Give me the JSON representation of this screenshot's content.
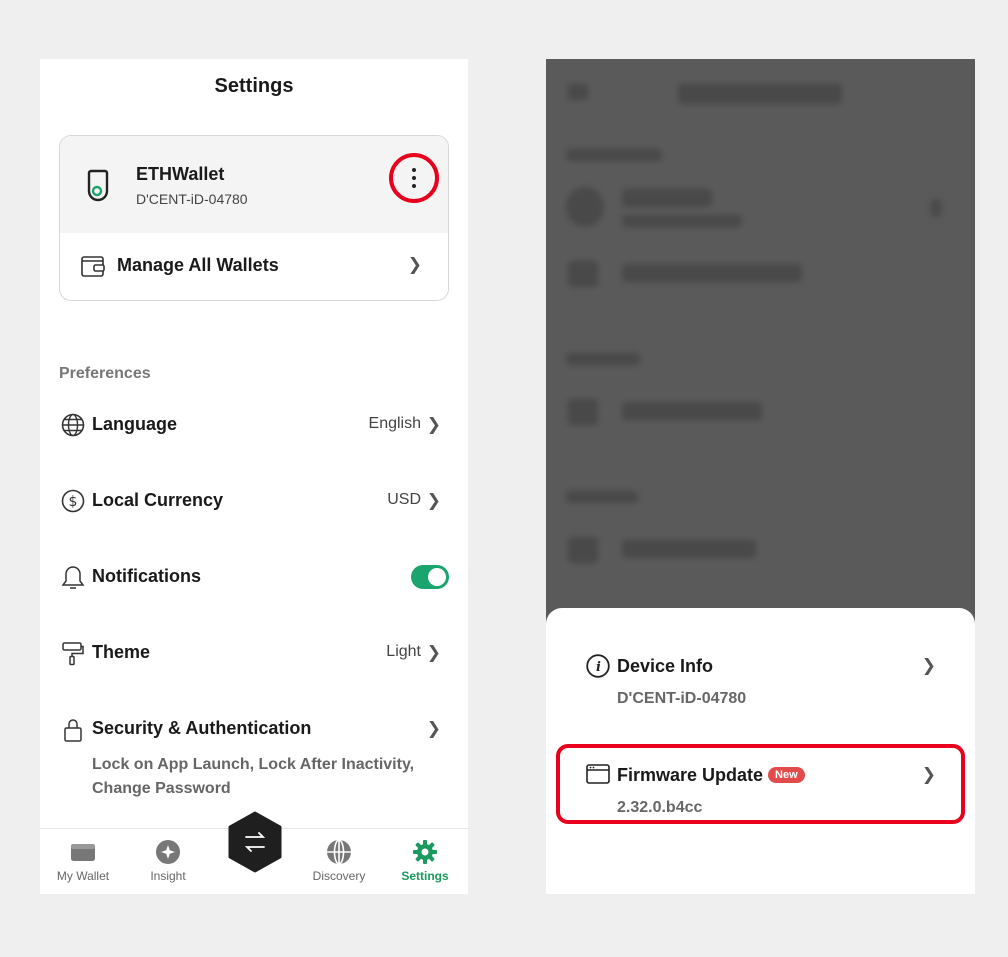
{
  "left": {
    "title": "Settings",
    "wallet": {
      "name": "ETHWallet",
      "id": "D'CENT-iD-04780",
      "menu_icon": "kebab-icon"
    },
    "manage_label": "Manage All Wallets",
    "preferences_label": "Preferences",
    "rows": {
      "language": {
        "label": "Language",
        "value": "English"
      },
      "currency": {
        "label": "Local Currency",
        "value": "USD"
      },
      "notifications": {
        "label": "Notifications",
        "enabled": true
      },
      "theme": {
        "label": "Theme",
        "value": "Light"
      },
      "security": {
        "label": "Security & Authentication",
        "sub": "Lock on App Launch, Lock After Inactivity, Change Password"
      }
    },
    "tabs": [
      {
        "label": "My Wallet",
        "icon": "wallet-icon"
      },
      {
        "label": "Insight",
        "icon": "insight-icon"
      },
      {
        "label": "Discovery",
        "icon": "globe-icon"
      },
      {
        "label": "Settings",
        "icon": "gear-icon",
        "active": true
      }
    ],
    "fab_icon": "swap-icon"
  },
  "right": {
    "device_info": {
      "label": "Device Info",
      "sub": "D'CENT-iD-04780"
    },
    "firmware": {
      "label": "Firmware Update",
      "badge": "New",
      "sub": "2.32.0.b4cc"
    }
  },
  "colors": {
    "accent_green": "#1a9a5e",
    "highlight_red": "#e8001c",
    "badge_red": "#e24b4b",
    "overlay": "#5a5a5a"
  }
}
